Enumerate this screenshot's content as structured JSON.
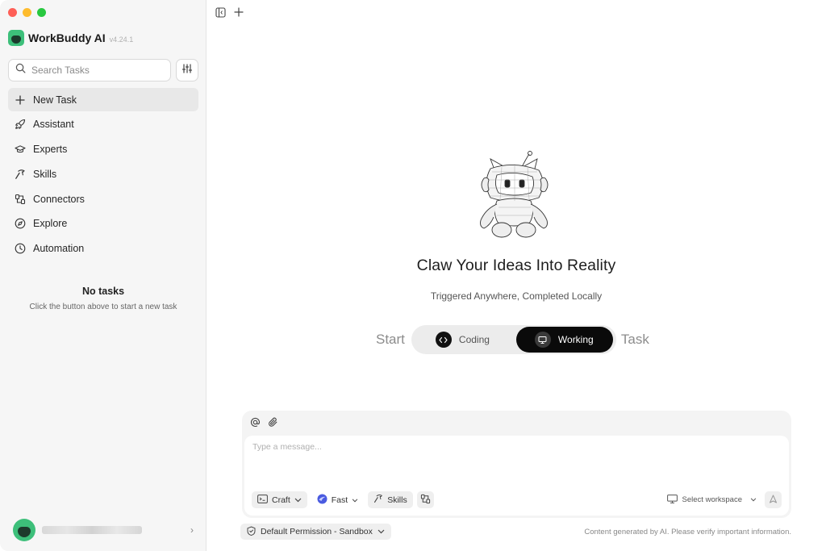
{
  "app": {
    "name": "WorkBuddy AI",
    "version": "v4.24.1"
  },
  "sidebar": {
    "search_placeholder": "Search Tasks",
    "items": [
      {
        "label": "New Task",
        "icon": "plus-icon"
      },
      {
        "label": "Assistant",
        "icon": "rocket-icon"
      },
      {
        "label": "Experts",
        "icon": "graduation-cap-icon"
      },
      {
        "label": "Skills",
        "icon": "hammer-icon"
      },
      {
        "label": "Connectors",
        "icon": "connector-icon"
      },
      {
        "label": "Explore",
        "icon": "compass-icon"
      },
      {
        "label": "Automation",
        "icon": "clock-icon"
      }
    ],
    "empty_title": "No tasks",
    "empty_subtitle": "Click the button above to start a new task"
  },
  "hero": {
    "title": "Claw Your Ideas Into Reality",
    "subtitle": "Triggered Anywhere, Completed Locally"
  },
  "mode": {
    "prefix": "Start",
    "suffix": "Task",
    "options": [
      {
        "label": "Coding",
        "icon": "code-icon",
        "selected": false
      },
      {
        "label": "Working",
        "icon": "monitor-icon",
        "selected": true
      }
    ]
  },
  "composer": {
    "placeholder": "Type a message...",
    "mode_label": "Craft",
    "model_label": "Fast",
    "skills_label": "Skills",
    "workspace_label": "Select workspace"
  },
  "footer": {
    "permission_label": "Default Permission - Sandbox",
    "disclaimer": "Content generated by AI. Please verify important information."
  },
  "colors": {
    "brand_green": "#3dbf7a",
    "selected_toggle": "#0a0a0a",
    "sidebar_bg": "#f6f6f6"
  }
}
